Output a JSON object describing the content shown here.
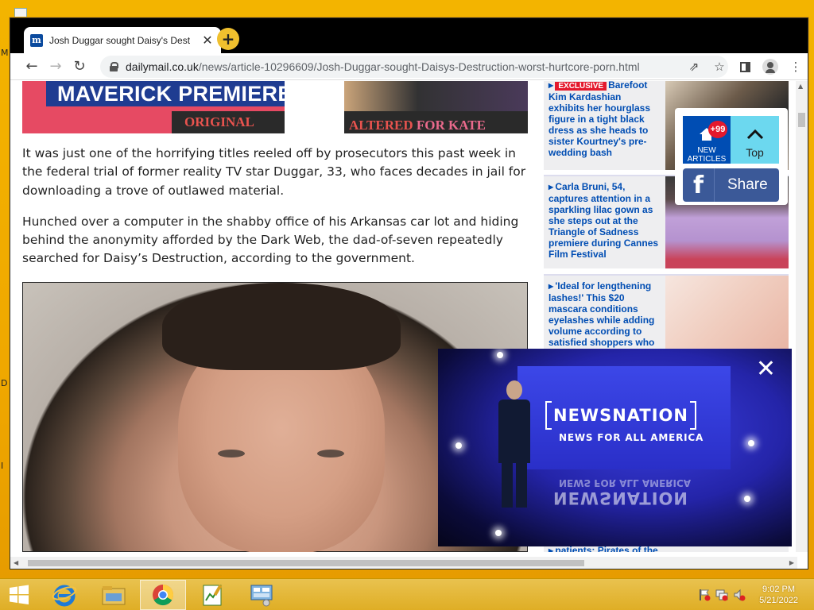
{
  "desktop": {
    "left_letters": [
      "M",
      "D",
      "I"
    ]
  },
  "browser": {
    "tab_title": "Josh Duggar sought Daisy's Dest",
    "tab_favicon_letter": "m",
    "url_host": "dailymail.co.uk",
    "url_path": "/news/article-10296609/Josh-Duggar-sought-Daisys-Destruction-worst-hurtcore-porn.html"
  },
  "hero": {
    "banner": "MAVERICK PREMIERE",
    "left_tag": "ORIGINAL",
    "right_tag": "ALTERED",
    "right_tag_suffix": " FOR KATE"
  },
  "article": {
    "paragraphs": [
      "It was just one of the horrifying titles reeled off by prosecutors this past week in the federal trial of former reality TV star Duggar, 33, who faces decades in jail for downloading a trove of outlawed material.",
      "Hunched over a computer in the shabby office of his Arkansas car lot and hiding behind the anonymity afforded by the Dark Web, the dad-of-seven repeatedly searched for Daisy’s Destruction, according to the government."
    ]
  },
  "sidebar": {
    "puffs": [
      {
        "badge": "EXCLUSIVE",
        "badge_suffix": "Barefoot",
        "text": "Kim Kardashian exhibits her hourglass figure in a tight black dress as she heads to sister Kourtney's pre-wedding bash"
      },
      {
        "text": "Carla Bruni, 54, captures attention in a sparkling lilac gown as she steps out at the Triangle of Sadness premiere during Cannes Film Festival"
      },
      {
        "text": "'Ideal for lengthening lashes!' This $20 mascara conditions eyelashes while adding volume according to satisfied shoppers who"
      },
      {
        "text": "patients: Pirates of the"
      }
    ]
  },
  "floating": {
    "new_articles_badge": "+99",
    "new_articles_label": "NEW ARTICLES",
    "top_label": "Top",
    "share_label": "Share",
    "share_icon": "f"
  },
  "video": {
    "brand": "NEWSNATION",
    "tagline": "NEWS FOR ALL AMERICA",
    "close_glyph": "✕"
  },
  "taskbar": {
    "time": "9:02 PM",
    "date": "5/21/2022"
  }
}
